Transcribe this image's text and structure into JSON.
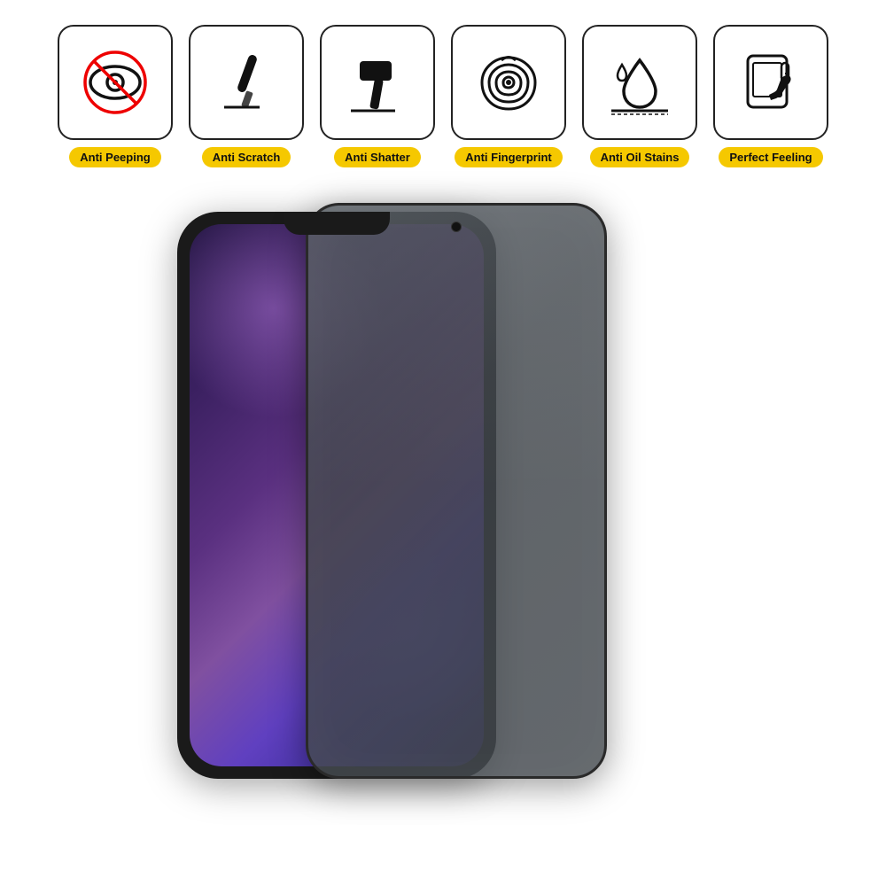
{
  "features": [
    {
      "id": "anti-peeping",
      "label": "Anti Peeping",
      "icon": "eye-slash"
    },
    {
      "id": "anti-scratch",
      "label": "Anti Scratch",
      "icon": "knife"
    },
    {
      "id": "anti-shatter",
      "label": "Anti Shatter",
      "icon": "hammer"
    },
    {
      "id": "anti-fingerprint",
      "label": "Anti Fingerprint",
      "icon": "fingerprint"
    },
    {
      "id": "anti-oil-stains",
      "label": "Anti Oil Stains",
      "icon": "water-drop"
    },
    {
      "id": "perfect-feeling",
      "label": "Perfect Feeling",
      "icon": "hand-touch"
    }
  ],
  "colors": {
    "label_bg": "#f5c800",
    "icon_border": "#222222",
    "phone_bg": "#1a1a1a",
    "privacy_glass": "rgba(60,65,70,0.82)"
  }
}
